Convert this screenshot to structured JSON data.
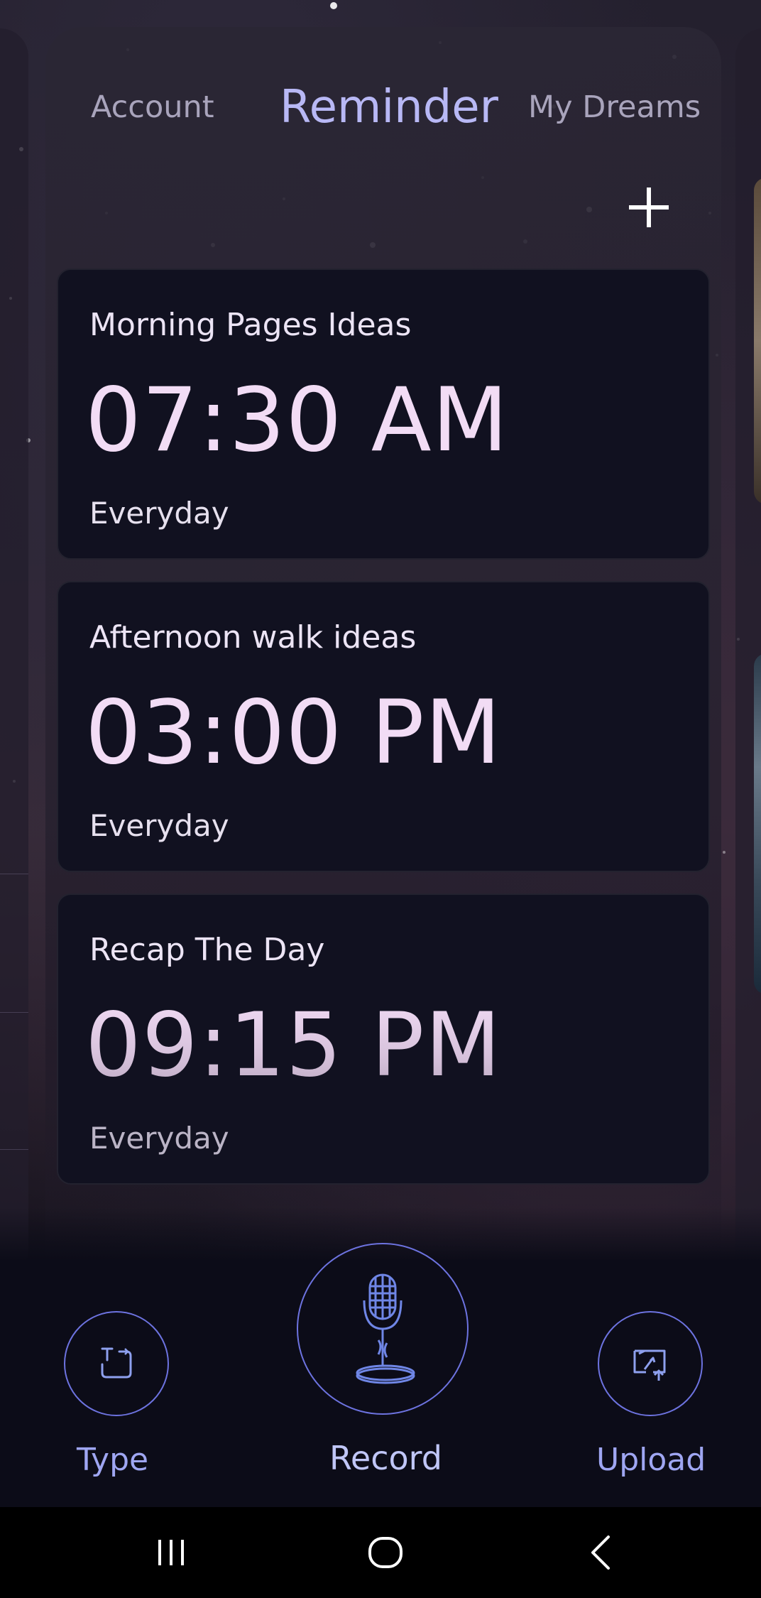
{
  "tabs": {
    "account": "Account",
    "reminder": "Reminder",
    "my_dreams": "My Dreams"
  },
  "add_icon": "plus-icon",
  "reminders": [
    {
      "title": "Morning Pages Ideas",
      "time": "07:30 AM",
      "repeat": "Everyday"
    },
    {
      "title": "Afternoon walk ideas",
      "time": "03:00 PM",
      "repeat": "Everyday"
    },
    {
      "title": "Recap The Day",
      "time": "09:15 PM",
      "repeat": "Everyday"
    }
  ],
  "actions": {
    "type": {
      "label": "Type",
      "icon": "text-cursor-icon"
    },
    "record": {
      "label": "Record",
      "icon": "microphone-icon"
    },
    "upload": {
      "label": "Upload",
      "icon": "upload-file-icon"
    }
  },
  "system_nav": {
    "recents_icon": "recents-icon",
    "home_icon": "home-icon",
    "back_icon": "back-icon"
  },
  "colors": {
    "accent": "#6d73e0",
    "active_tab": "#b8b8f5",
    "time_text": "#f2dcf5",
    "card_bg": "#111120"
  }
}
